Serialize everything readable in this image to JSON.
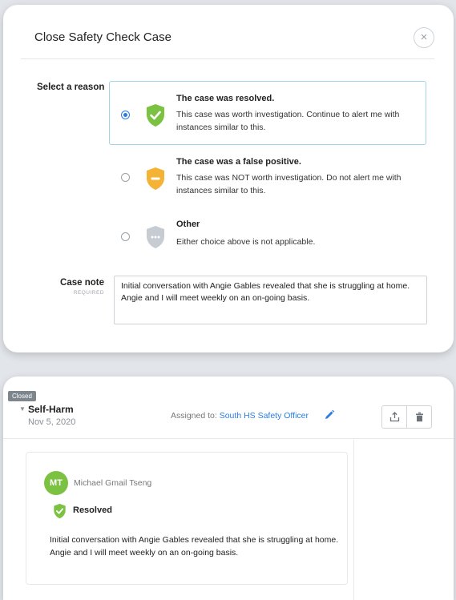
{
  "modal": {
    "title": "Close Safety Check Case",
    "close_icon": "×",
    "select_reason_label": "Select a reason",
    "options": [
      {
        "id": "resolved",
        "title": "The case was resolved.",
        "description": "This case was worth investigation. Continue to alert me with instances similar to this.",
        "icon": "shield-check-icon",
        "color": "#7cc242",
        "selected": true
      },
      {
        "id": "false-positive",
        "title": "The case was a false positive.",
        "description": "This case was NOT worth investigation. Do not alert me with instances similar to this.",
        "icon": "shield-minus-icon",
        "color": "#f5b335",
        "selected": false
      },
      {
        "id": "other",
        "title": "Other",
        "description": "Either choice above is not applicable.",
        "icon": "shield-ellipsis-icon",
        "color": "#c6ccd2",
        "selected": false
      }
    ],
    "case_note_label": "Case note",
    "case_note_required": "REQUIRED",
    "case_note_value": "Initial conversation with Angie Gables revealed that she is struggling at home. Angie and I will meet weekly on an on-going basis."
  },
  "case": {
    "status_tag": "Closed",
    "type": "Self-Harm",
    "date": "Nov 5, 2020",
    "assigned_prefix": "Assigned to:",
    "assigned_to": "South HS Safety Officer",
    "note": {
      "avatar_initials": "MT",
      "avatar_color": "#7cc242",
      "author": "Michael Gmail Tseng",
      "status": "Resolved",
      "text": "Initial conversation with Angie Gables revealed that she is struggling at home. Angie and I will meet weekly on an on-going basis."
    }
  },
  "colors": {
    "accent_blue": "#2a7de1",
    "selected_border": "#9fd4ea",
    "resolved_green": "#7cc242",
    "warning_orange": "#f5b335",
    "neutral_gray": "#c6ccd2"
  }
}
